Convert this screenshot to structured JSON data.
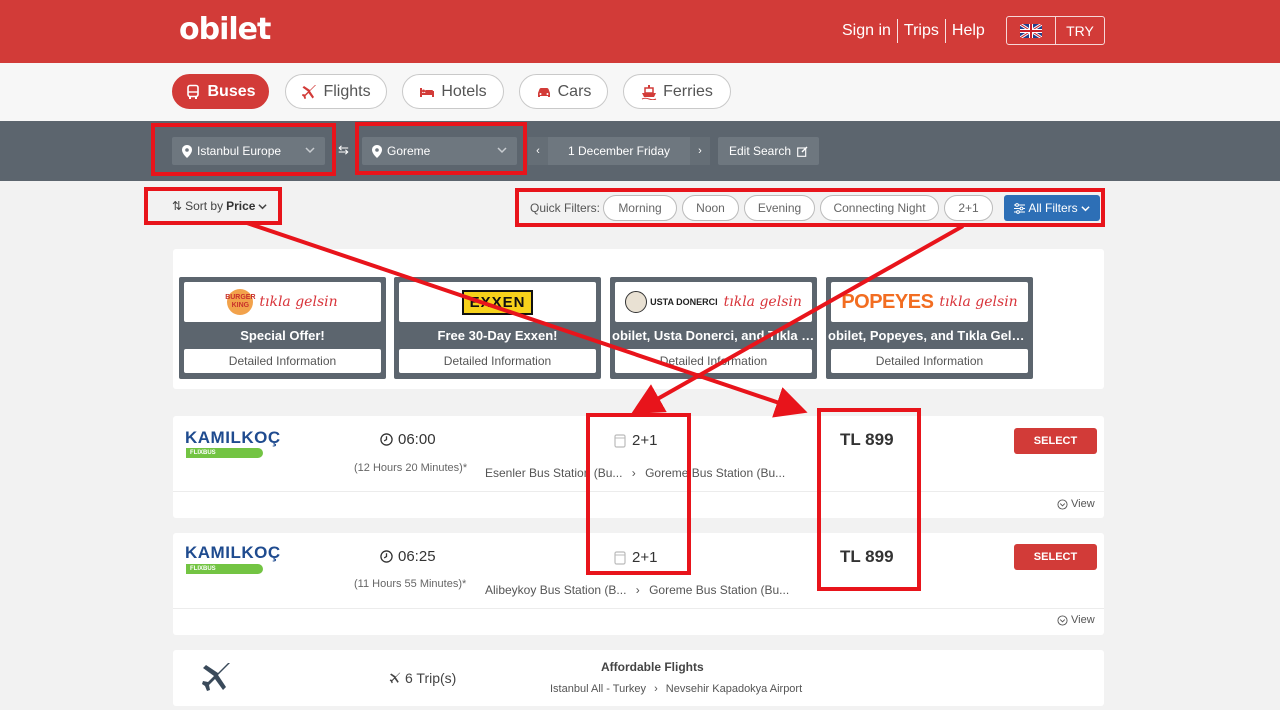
{
  "header": {
    "logo": "obilet",
    "links": [
      "Sign in",
      "Trips",
      "Help"
    ],
    "currency": "TRY",
    "flag_icon": "uk-flag-icon"
  },
  "tabs": [
    {
      "label": "Buses",
      "icon": "bus-icon",
      "active": true
    },
    {
      "label": "Flights",
      "icon": "plane-icon",
      "active": false
    },
    {
      "label": "Hotels",
      "icon": "bed-icon",
      "active": false
    },
    {
      "label": "Cars",
      "icon": "car-icon",
      "active": false
    },
    {
      "label": "Ferries",
      "icon": "ferry-icon",
      "active": false
    }
  ],
  "search": {
    "origin": "Istanbul Europe",
    "destination": "Goreme",
    "date": "1 December Friday",
    "edit_label": "Edit Search"
  },
  "sort": {
    "prefix": "Sort by",
    "value": "Price"
  },
  "quick_filters": {
    "label": "Quick Filters:",
    "chips": [
      "Morning",
      "Noon",
      "Evening",
      "Connecting Night",
      "2+1"
    ],
    "all_label": "All Filters"
  },
  "promos": [
    {
      "title": "Special Offer!",
      "info": "Detailed Information"
    },
    {
      "title": "Free 30-Day Exxen!",
      "info": "Detailed Information"
    },
    {
      "title": "obilet, Usta Donerci, and Tıkla G...",
      "info": "Detailed Information"
    },
    {
      "title": "obilet, Popeyes, and Tıkla Gelsin...",
      "info": "Detailed Information"
    }
  ],
  "promo_brands": {
    "burger_king": "BURGER KING",
    "tikla": "tıkla gelsin",
    "exxen": "EXXEN",
    "usta": "USTA DONERCI",
    "popeyes": "POPEYES"
  },
  "trips": [
    {
      "operator": "KAMILKOÇ",
      "operator_sub": "FLIXBUS",
      "time": "06:00",
      "duration": "(12 Hours 20 Minutes)*",
      "seat": "2+1",
      "from": "Esenler Bus Station (Bu...",
      "to": "Goreme Bus Station (Bu...",
      "price": "TL 899",
      "select": "SELECT",
      "view": "View"
    },
    {
      "operator": "KAMILKOÇ",
      "operator_sub": "FLIXBUS",
      "time": "06:25",
      "duration": "(11 Hours 55 Minutes)*",
      "seat": "2+1",
      "from": "Alibeykoy Bus Station (B...",
      "to": "Goreme Bus Station (Bu...",
      "price": "TL 899",
      "select": "SELECT",
      "view": "View"
    }
  ],
  "flight_promo": {
    "trips": "6 Trip(s)",
    "title": "Affordable Flights",
    "from": "Istanbul All - Turkey",
    "to": "Nevsehir Kapadokya Airport"
  },
  "colors": {
    "brand_red": "#d23b38",
    "search_bg": "#5c656e",
    "filter_blue": "#2d6fb6",
    "annotation_red": "#e8141b"
  }
}
